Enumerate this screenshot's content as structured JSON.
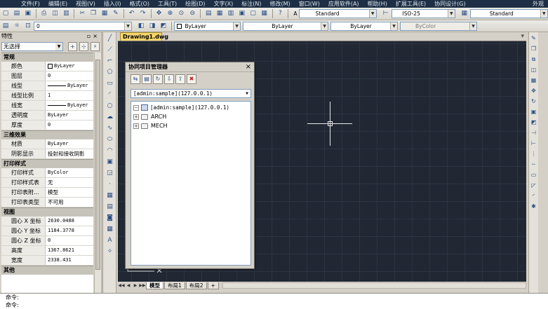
{
  "menubar": {
    "items": [
      "文件(F)",
      "编辑(E)",
      "视图(V)",
      "插入(I)",
      "格式(O)",
      "工具(T)",
      "绘图(D)",
      "文字(X)",
      "标注(N)",
      "修改(M)",
      "窗口(W)",
      "应用软件(A)",
      "帮助(H)",
      "扩展工具(E)",
      "协同设计(G)"
    ],
    "right_label": "外观"
  },
  "toolbar1": {
    "text_style_label": "A",
    "text_style_value": "Standard",
    "dim_style_value": "ISO-25",
    "table_style_value": "Standard"
  },
  "toolbar2": {
    "layer_value": "0",
    "color_value": "ByLayer",
    "linetype_value": "ByLayer",
    "lineweight_value": "ByLayer",
    "plotstyle_value": "ByColor"
  },
  "properties": {
    "title": "特性",
    "selection": "无选择",
    "sections": [
      {
        "name": "常规",
        "rows": [
          {
            "k": "颜色",
            "v": "ByLayer",
            "kind": "swatch"
          },
          {
            "k": "图层",
            "v": "0"
          },
          {
            "k": "线型",
            "v": "ByLayer",
            "kind": "line"
          },
          {
            "k": "线型比例",
            "v": "1"
          },
          {
            "k": "线宽",
            "v": "ByLayer",
            "kind": "line"
          },
          {
            "k": "透明度",
            "v": "ByLayer"
          },
          {
            "k": "厚度",
            "v": "0"
          }
        ]
      },
      {
        "name": "三维效果",
        "rows": [
          {
            "k": "材质",
            "v": "ByLayer"
          },
          {
            "k": "阴影显示",
            "v": "投射和接收阴影",
            "kind": "cjk"
          }
        ]
      },
      {
        "name": "打印样式",
        "rows": [
          {
            "k": "打印样式",
            "v": "ByColor"
          },
          {
            "k": "打印样式表",
            "v": "无",
            "kind": "cjk"
          },
          {
            "k": "打印表附...",
            "v": "模型",
            "kind": "cjk"
          },
          {
            "k": "打印表类型",
            "v": "不可用",
            "kind": "cjk"
          }
        ]
      },
      {
        "name": "视图",
        "rows": [
          {
            "k": "圆心 X 坐标",
            "v": "2630.0488"
          },
          {
            "k": "圆心 Y 坐标",
            "v": "1184.3778"
          },
          {
            "k": "圆心 Z 坐标",
            "v": "0"
          },
          {
            "k": "高度",
            "v": "1367.8621"
          },
          {
            "k": "宽度",
            "v": "2338.431"
          }
        ]
      },
      {
        "name": "其他",
        "rows": []
      }
    ]
  },
  "document": {
    "tab_title": "Drawing1.dwg"
  },
  "layout_tabs": [
    "模型",
    "布局1",
    "布局2"
  ],
  "palette": {
    "title": "协同项目管理器",
    "server": "[admin:sample](127.0.0.1)",
    "tree": {
      "root": "[admin:sample](127.0.0.1)",
      "children": [
        "ARCH",
        "MECH"
      ]
    }
  },
  "command": {
    "lines": [
      "命令:",
      "命令:"
    ]
  }
}
